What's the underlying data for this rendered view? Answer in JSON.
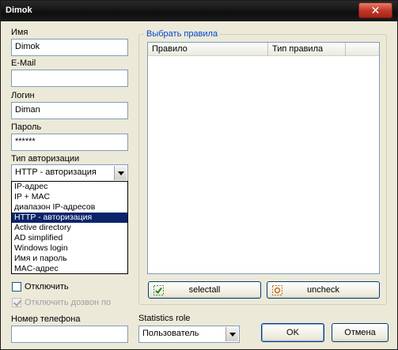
{
  "window": {
    "title": "Dimok",
    "close_glyph": "✕"
  },
  "form": {
    "name_label": "Имя",
    "name_value": "Dimok",
    "email_label": "E-Mail",
    "email_value": "",
    "login_label": "Логин",
    "login_value": "Diman",
    "password_label": "Пароль",
    "password_value": "******",
    "auth_label": "Тип авторизации",
    "auth_value": "HTTP - авторизация",
    "auth_options": [
      "IP-адрес",
      "IP + MAC",
      "диапазон IP-адресов",
      "HTTP - авторизация",
      "Active directory",
      "AD simplified",
      "Windows login",
      "Имя и пароль",
      "MAC-адрес"
    ],
    "disable_label": "Отключить",
    "disable_dialup_label": "Отключить дозвон по",
    "phone_label": "Номер телефона",
    "phone_value": ""
  },
  "rules": {
    "group_title": "Выбрать правила",
    "col_rule": "Правило",
    "col_rule_type": "Тип правила",
    "selectall_label": "selectall",
    "uncheck_label": "uncheck"
  },
  "statistics": {
    "label": "Statistics role",
    "value": "Пользователь"
  },
  "buttons": {
    "ok": "OK",
    "cancel": "Отмена"
  },
  "icons": {
    "selectall": "check-icon",
    "uncheck": "uncheck-icon",
    "dropdown": "chevron-down-icon"
  }
}
